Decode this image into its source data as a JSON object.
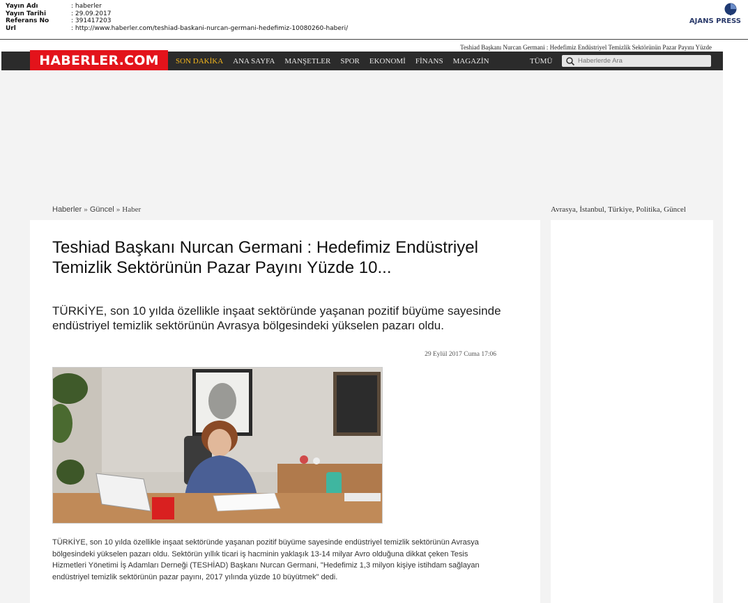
{
  "meta": {
    "rows": [
      {
        "key": "Yayın Adı",
        "value": ": haberler"
      },
      {
        "key": "Yayın Tarihi",
        "value": ": 29.09.2017"
      },
      {
        "key": "Referans No",
        "value": ": 391417203"
      },
      {
        "key": "Url",
        "value": ": http://www.haberler.com/teshiad-baskani-nurcan-germani-hedefimiz-10080260-haberi/"
      }
    ],
    "agency": "AJANS PRESS"
  },
  "topline": "Teshiad Başkanı Nurcan Germani : Hedefimiz Endüstriyel Temizlik Sektörünün Pazar Payını Yüzde",
  "header": {
    "logo": "HABERLER.COM",
    "nav": [
      "SON DAKİKA",
      "ANA SAYFA",
      "MANŞETLER",
      "SPOR",
      "EKONOMİ",
      "FİNANS",
      "MAGAZİN"
    ],
    "all_label": "TÜMÜ",
    "search_placeholder": "Haberlerde Ara",
    "active_color": "#f2b51c",
    "brand_color": "#e3131b"
  },
  "breadcrumb": {
    "home": "Haberler",
    "section": "Güncel",
    "page": "Haber",
    "separator": "»"
  },
  "tags": "Avrasya, İstanbul, Türkiye, Politika, Güncel",
  "article": {
    "title": "Teshiad Başkanı Nurcan Germani : Hedefimiz Endüstriyel Temizlik Sektörünün Pazar Payını Yüzde 10...",
    "summary": "TÜRKİYE, son 10 yılda özellikle inşaat sektöründe yaşanan pozitif büyüme sayesinde endüstriyel temizlik sektörünün Avrasya bölgesindeki yükselen pazarı oldu.",
    "date": "29 Eylül 2017 Cuma 17:06",
    "body": "TÜRKİYE, son 10 yılda özellikle inşaat sektöründe yaşanan pozitif büyüme sayesinde endüstriyel temizlik sektörünün Avrasya bölgesindeki yükselen pazarı oldu. Sektörün yıllık ticari iş hacminin yaklaşık 13-14 milyar Avro olduğuna dikkat çeken Tesis Hizmetleri Yönetimi İş Adamları Derneği (TESHİAD) Başkanı Nurcan Germani, \"Hedefimiz 1,3 milyon kişiye istihdam sağlayan endüstriyel temizlik sektörünün pazar payını, 2017 yılında yüzde 10 büyütmek\" dedi."
  }
}
